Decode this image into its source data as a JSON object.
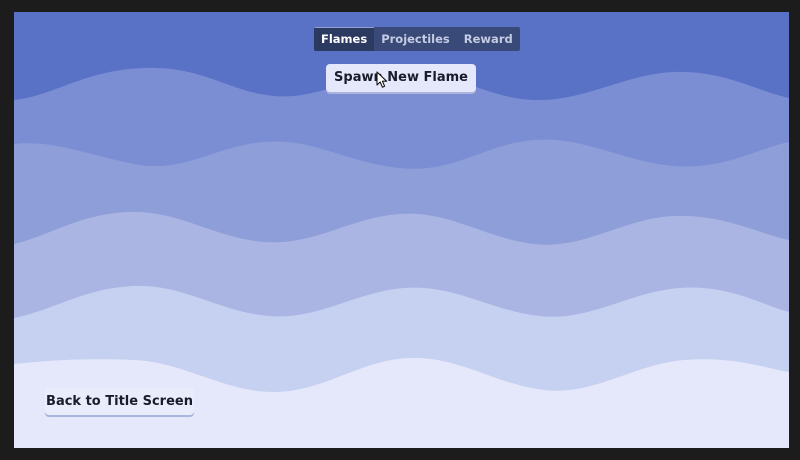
{
  "tabs": [
    {
      "label": "Flames",
      "active": true
    },
    {
      "label": "Projectiles",
      "active": false
    },
    {
      "label": "Reward",
      "active": false
    }
  ],
  "spawn_button": {
    "label": "Spawn New Flame"
  },
  "back_button": {
    "label": "Back to Title Screen"
  },
  "cursor": {
    "icon": "mouse-pointer-icon"
  },
  "colors": {
    "wave_1": "#5a72c6",
    "wave_2": "#7b8ed4",
    "wave_3": "#8d9ed8",
    "wave_4": "#aab5e3",
    "wave_5": "#c6d0f0",
    "wave_6": "#e4e8fa"
  }
}
